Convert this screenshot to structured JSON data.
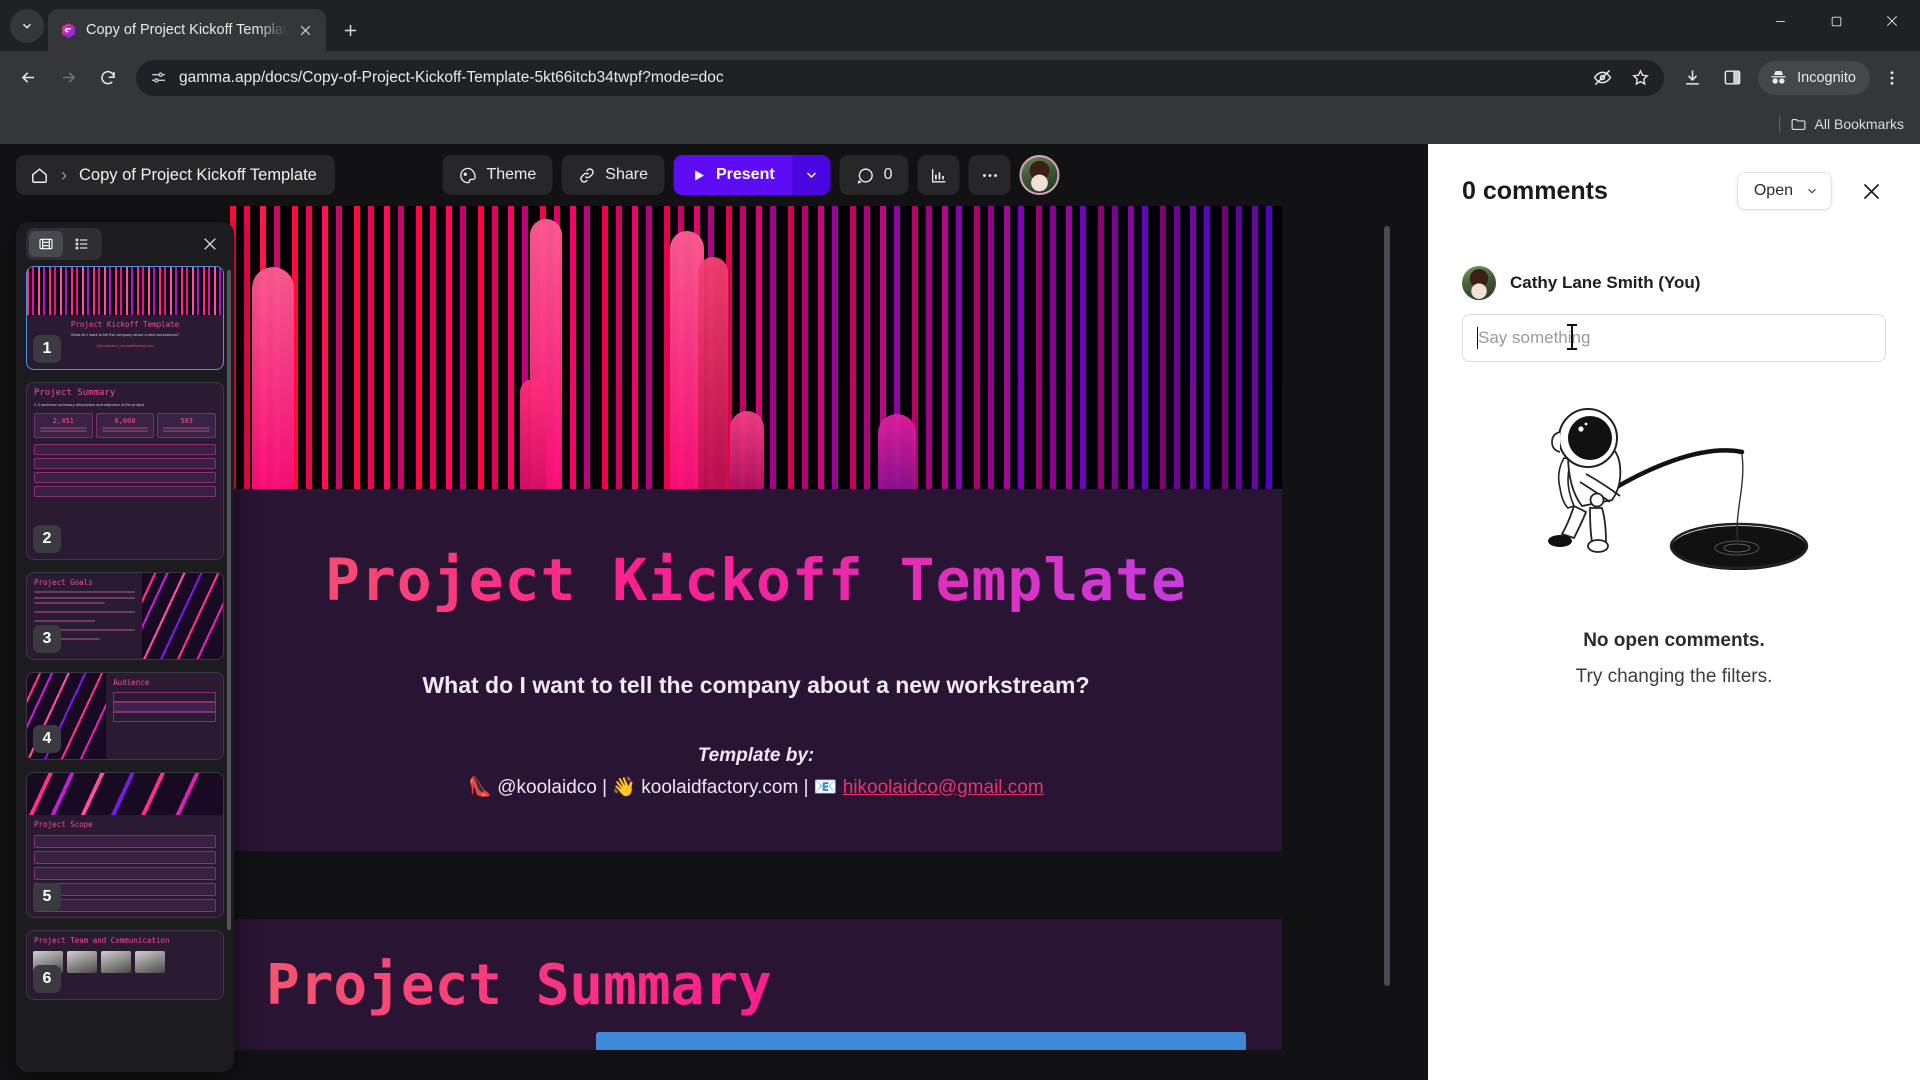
{
  "browser": {
    "tab": {
      "title": "Copy of Project Kickoff Templat",
      "favicon_name": "gamma-logo-icon"
    },
    "tab_list_label": "Search tabs",
    "new_tab_label": "New tab",
    "window": {
      "minimize": "Minimize",
      "maximize": "Restore",
      "close": "Close"
    },
    "nav": {
      "back": "Back",
      "forward": "Forward",
      "reload": "Reload"
    },
    "omnibox": {
      "url": "gamma.app/docs/Copy-of-Project-Kickoff-Template-5kt66itcb34twpf?mode=doc",
      "site_info_icon": "site-settings-icon",
      "icons": [
        "eye-slash-icon",
        "bookmark-star-icon"
      ]
    },
    "toolbar_icons": [
      "download-icon",
      "side-panel-icon"
    ],
    "incognito_label": "Incognito",
    "menu_label": "Customize and control Google Chrome",
    "bookmarks": {
      "all_label": "All Bookmarks",
      "folder_icon": "folder-icon"
    }
  },
  "app": {
    "breadcrumb": {
      "home_icon": "home-icon",
      "separator": "›",
      "title": "Copy of Project Kickoff Template"
    },
    "toolbar": {
      "theme_label": "Theme",
      "share_label": "Share",
      "present_label": "Present",
      "present_caret": "chevron-down-icon",
      "comment_count": "0",
      "analytics_icon": "analytics-icon",
      "more_icon": "more-horizontal-icon",
      "avatar_name": "user-avatar"
    },
    "slide_panel": {
      "view_grid_icon": "filmstrip-icon",
      "view_list_icon": "list-icon",
      "close_icon": "close-icon",
      "slides": [
        {
          "num": "1",
          "title": "Project Kickoff Template",
          "subtitle": "What do I want to tell the company about a new workstream?",
          "selected": true
        },
        {
          "num": "2",
          "title": "Project Summary",
          "subtitle": "2-3 sentence summary description and objective of the project",
          "stats": [
            "2,451",
            "6,000",
            "503"
          ],
          "selected": false
        },
        {
          "num": "3",
          "title": "Project Goals",
          "selected": false
        },
        {
          "num": "4",
          "title": "Audience",
          "selected": false
        },
        {
          "num": "5",
          "title": "Project Scope",
          "selected": false
        },
        {
          "num": "6",
          "title": "Project Team and Communication",
          "selected": false
        }
      ]
    },
    "slide": {
      "title": "Project Kickoff Template",
      "subtitle": "What do I want to tell the company about a new workstream?",
      "credit_label": "Template by:",
      "credit_handle": "@koolaidco",
      "credit_site": "koolaidfactory.com",
      "credit_email": "hikoolaidco@gmail.com",
      "sep": "|",
      "emoji_handle": "👠",
      "emoji_site": "👋",
      "emoji_email": "📧"
    },
    "next_slide": {
      "title": "Project Summary"
    }
  },
  "comments": {
    "heading": "0 comments",
    "filter_label": "Open",
    "filter_caret": "chevron-down-icon",
    "close_icon": "close-icon",
    "user_name": "Cathy Lane Smith (You)",
    "input_placeholder": "Say something",
    "input_value": "",
    "empty_title": "No open comments.",
    "empty_subtitle": "Try changing the filters.",
    "illustration_name": "astronaut-fishing-illustration"
  },
  "colors": {
    "accent_purple": "#5d0cf5",
    "slide_bg": "#2a1433",
    "pink": "#ff1e8e",
    "chrome_bg": "#202124",
    "toolbar_bg": "#35363a"
  }
}
